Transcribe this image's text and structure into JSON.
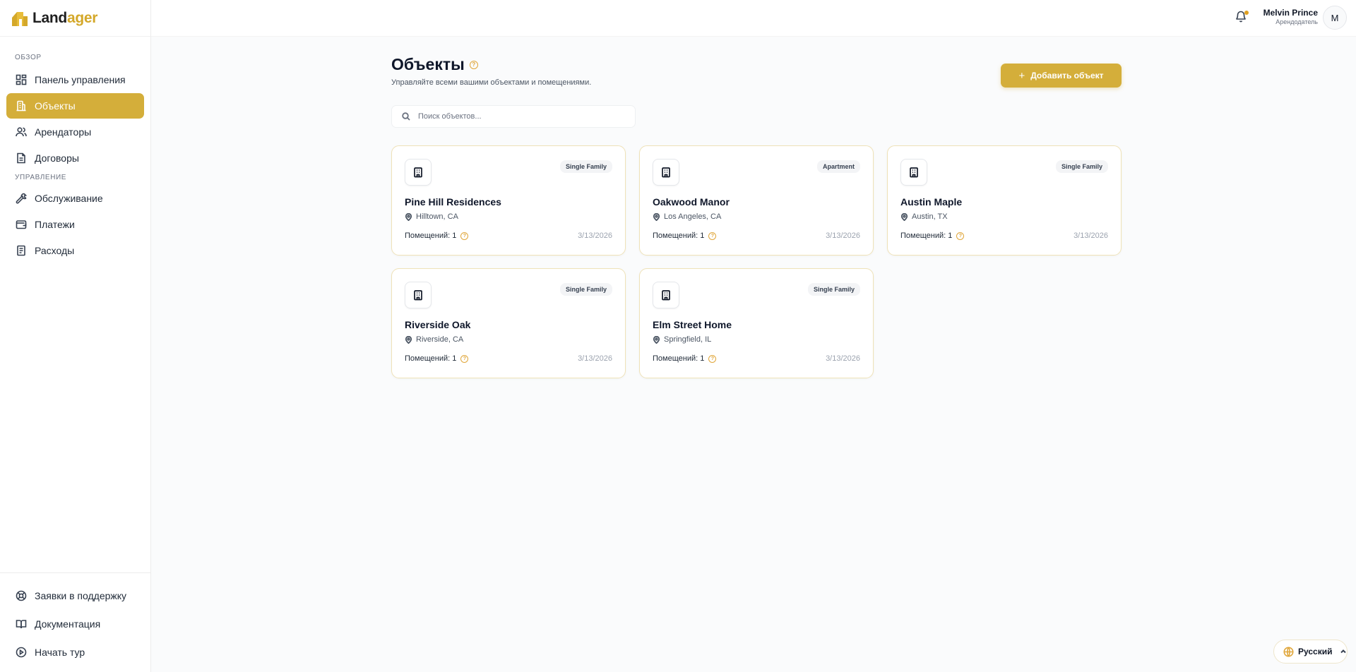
{
  "brand": {
    "name_part1": "Land",
    "name_part2": "ager"
  },
  "sidebar": {
    "sections": [
      {
        "title": "ОБЗОР"
      },
      {
        "title": "УПРАВЛЕНИЕ"
      }
    ],
    "items": [
      {
        "label": "Панель управления",
        "icon": "dashboard-icon"
      },
      {
        "label": "Объекты",
        "icon": "building-icon",
        "active": true
      },
      {
        "label": "Арендаторы",
        "icon": "users-icon"
      },
      {
        "label": "Договоры",
        "icon": "document-icon"
      },
      {
        "label": "Обслуживание",
        "icon": "wrench-icon"
      },
      {
        "label": "Платежи",
        "icon": "wallet-icon"
      },
      {
        "label": "Расходы",
        "icon": "receipt-icon"
      }
    ],
    "bottom_items": [
      {
        "label": "Заявки в поддержку",
        "icon": "lifebuoy-icon"
      },
      {
        "label": "Документация",
        "icon": "book-icon"
      },
      {
        "label": "Начать тур",
        "icon": "play-circle-icon"
      }
    ]
  },
  "header": {
    "user_name": "Melvin Prince",
    "user_role": "Арендодатель",
    "avatar_initial": "M",
    "notification_dot_color": "#e0a020"
  },
  "main": {
    "title": "Объекты",
    "subtitle": "Управляйте всеми вашими объектами и помещениями.",
    "add_button": "Добавить объект",
    "search_placeholder": "Поиск объектов...",
    "properties": [
      {
        "name": "Pine Hill Residences",
        "location": "Hilltown, CA",
        "type": "Single Family",
        "units_label": "Помещений: 1",
        "date": "3/13/2026"
      },
      {
        "name": "Oakwood Manor",
        "location": "Los Angeles, CA",
        "type": "Apartment",
        "units_label": "Помещений: 1",
        "date": "3/13/2026"
      },
      {
        "name": "Austin Maple",
        "location": "Austin, TX",
        "type": "Single Family",
        "units_label": "Помещений: 1",
        "date": "3/13/2026"
      },
      {
        "name": "Riverside Oak",
        "location": "Riverside, CA",
        "type": "Single Family",
        "units_label": "Помещений: 1",
        "date": "3/13/2026"
      },
      {
        "name": "Elm Street Home",
        "location": "Springfield, IL",
        "type": "Single Family",
        "units_label": "Помещений: 1",
        "date": "3/13/2026"
      }
    ]
  },
  "language": {
    "label": "Русский"
  },
  "colors": {
    "accent": "#d4ae3a",
    "brand_secondary": "#d4a82a",
    "card_border": "#efe2b8"
  }
}
